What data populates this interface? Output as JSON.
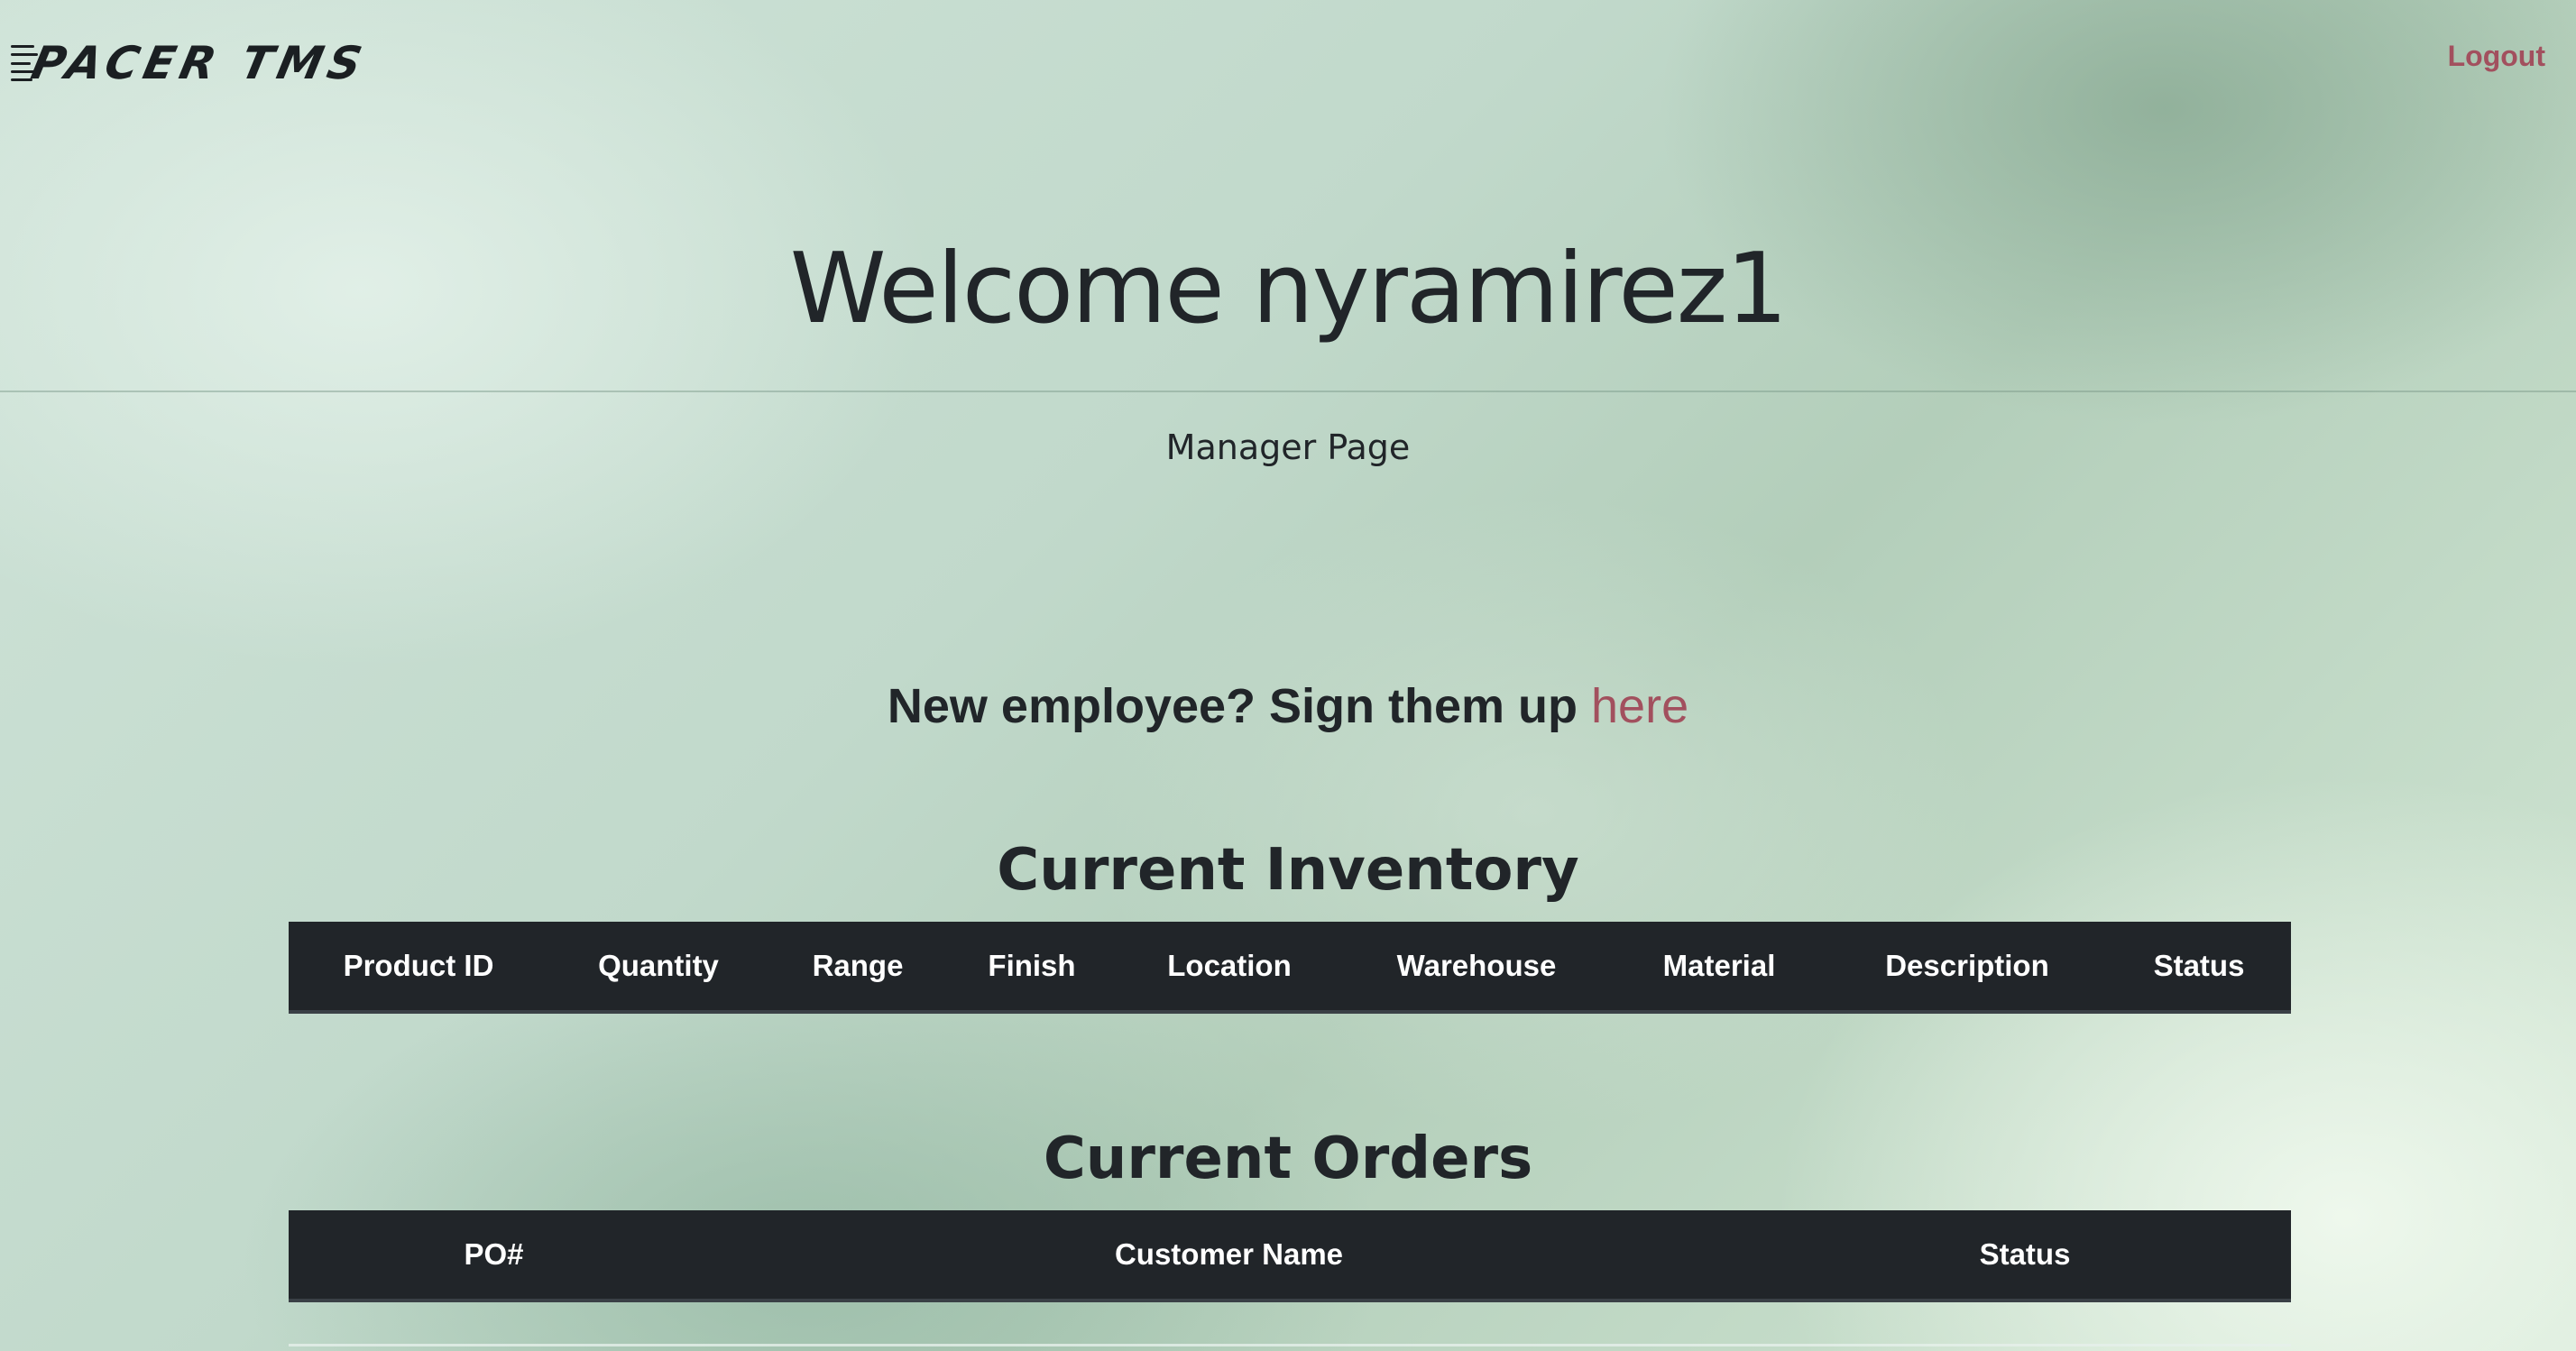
{
  "header": {
    "brand": "PACER TMS",
    "logout_label": "Logout"
  },
  "hero": {
    "welcome": "Welcome nyramirez1",
    "subtitle": "Manager Page"
  },
  "signup": {
    "prompt": "New employee? Sign them up ",
    "link_label": "here"
  },
  "inventory": {
    "title": "Current Inventory",
    "columns": [
      "Product ID",
      "Quantity",
      "Range",
      "Finish",
      "Location",
      "Warehouse",
      "Material",
      "Description",
      "Status"
    ]
  },
  "orders": {
    "title": "Current Orders",
    "columns": [
      "PO#",
      "Customer Name",
      "Status"
    ]
  },
  "colors": {
    "accent_link": "#a2505e",
    "table_header_bg": "#212529",
    "text": "#212529"
  }
}
